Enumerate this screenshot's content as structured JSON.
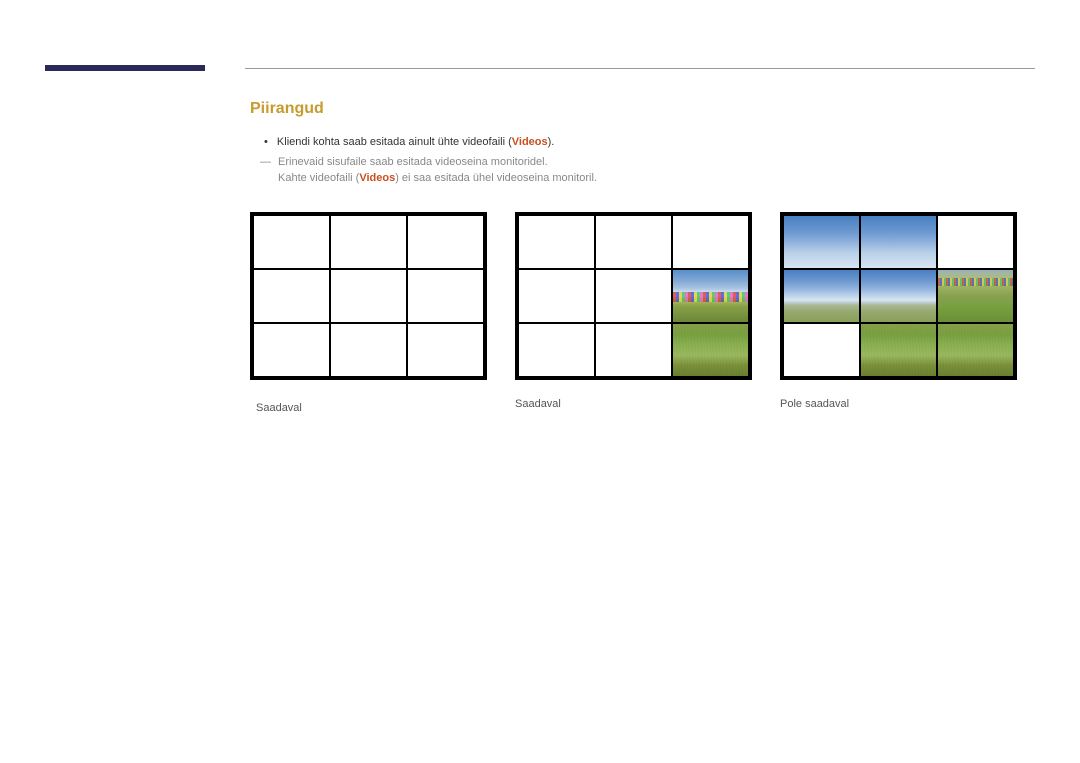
{
  "section": {
    "title": "Piirangud"
  },
  "text": {
    "bullet1_pre": "Kliendi kohta saab esitada ainult ühte videofaili (",
    "bullet1_highlight": "Videos",
    "bullet1_post": ").",
    "sub1": "Erinevaid sisufaile saab esitada videoseina monitoridel.",
    "sub2_pre": "Kahte videofaili (",
    "sub2_highlight": "Videos",
    "sub2_post": ") ei saa esitada ühel videoseina monitoril."
  },
  "captions": {
    "grid1": "Saadaval",
    "grid2": "Saadaval",
    "grid3": "Pole saadaval"
  }
}
